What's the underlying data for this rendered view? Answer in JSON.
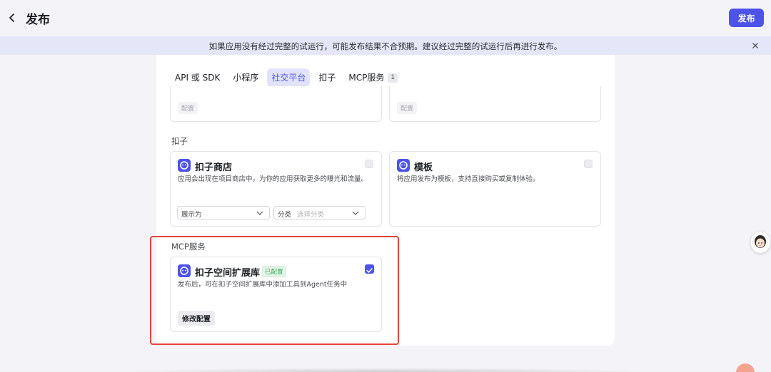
{
  "header": {
    "title": "发布",
    "publish_label": "发布"
  },
  "banner": {
    "text": "如果应用没有经过完整的试运行，可能发布结果不合预期。建议经过完整的试运行后再进行发布。"
  },
  "tabs": [
    {
      "label": "API 或 SDK",
      "active": false
    },
    {
      "label": "小程序",
      "active": false
    },
    {
      "label": "社交平台",
      "active": true
    },
    {
      "label": "扣子",
      "active": false
    },
    {
      "label": "MCP服务",
      "active": false,
      "badge": "1"
    }
  ],
  "top_cards": [
    {
      "tag": "配置"
    },
    {
      "tag": "配置"
    }
  ],
  "sections": {
    "koozi": {
      "label": "扣子",
      "cards": [
        {
          "title": "扣子商店",
          "desc": "应用会出现在项目商店中，为你的应用获取更多的曝光和流量。",
          "checked": false,
          "select_display": "展示为",
          "select_category_label": "分类",
          "select_category_placeholder": "选择分类"
        },
        {
          "title": "模板",
          "desc": "将应用发布为模板，支持直接购买或复制体验。",
          "checked": false
        }
      ]
    },
    "mcp": {
      "label": "MCP服务",
      "card": {
        "title": "扣子空间扩展库",
        "status_tag": "已配置",
        "desc": "发布后，可在扣子空间扩展库中添加工具到Agent任务中",
        "checked": true,
        "edit_label": "修改配置"
      }
    }
  },
  "colors": {
    "accent": "#4d53e8",
    "highlight_border": "#e3443a",
    "success": "#3ba55a"
  }
}
